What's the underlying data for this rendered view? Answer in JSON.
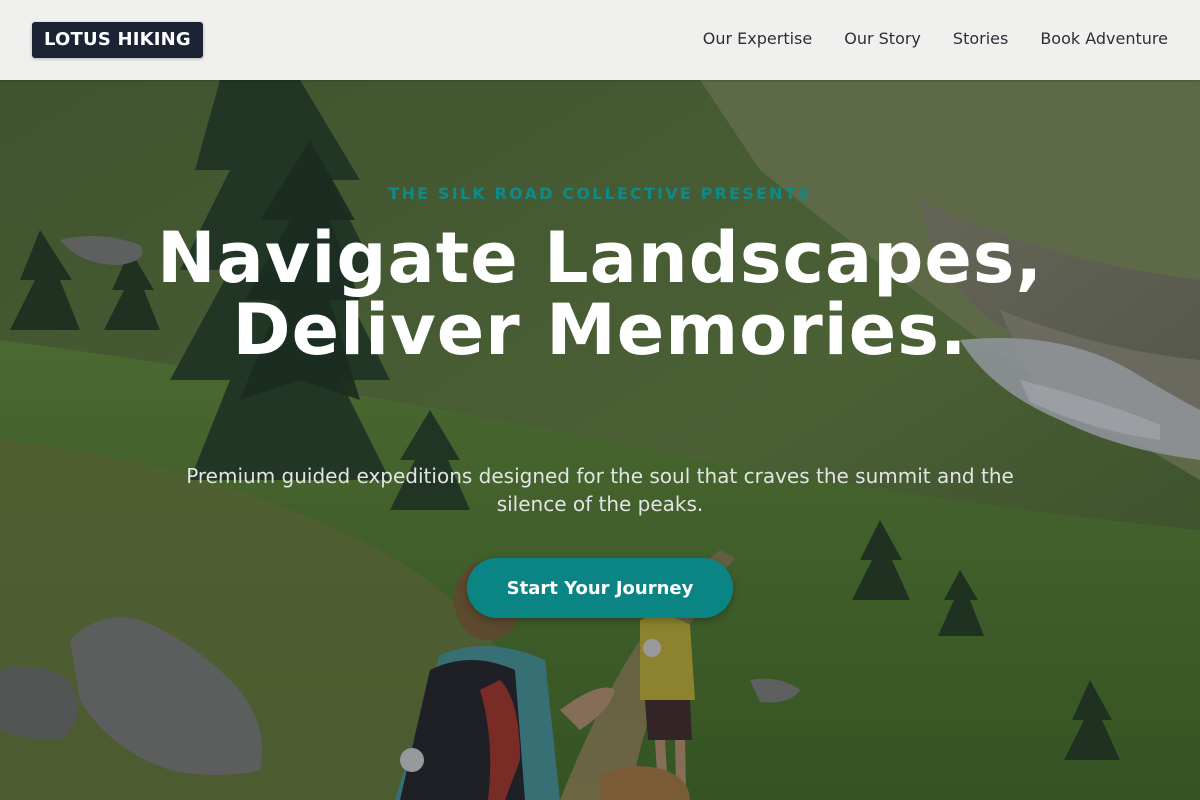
{
  "brand": {
    "logo_text": "LOTUS HIKING"
  },
  "nav": {
    "items": [
      {
        "label": "Our Expertise"
      },
      {
        "label": "Our Story"
      },
      {
        "label": "Stories"
      },
      {
        "label": "Book Adventure"
      }
    ]
  },
  "hero": {
    "eyebrow": "THE SILK ROAD COLLECTIVE PRESENTS",
    "headline": "Navigate Landscapes, Deliver Memories.",
    "subhead": "Premium guided expeditions designed for the soul that craves the summit and the silence of the peaks.",
    "cta_label": "Start Your Journey",
    "background_image": "mountain-hikers-photo"
  },
  "colors": {
    "accent": "#0b8484",
    "logo_bg": "#1c2335",
    "header_bg": "#f0f0ef"
  }
}
